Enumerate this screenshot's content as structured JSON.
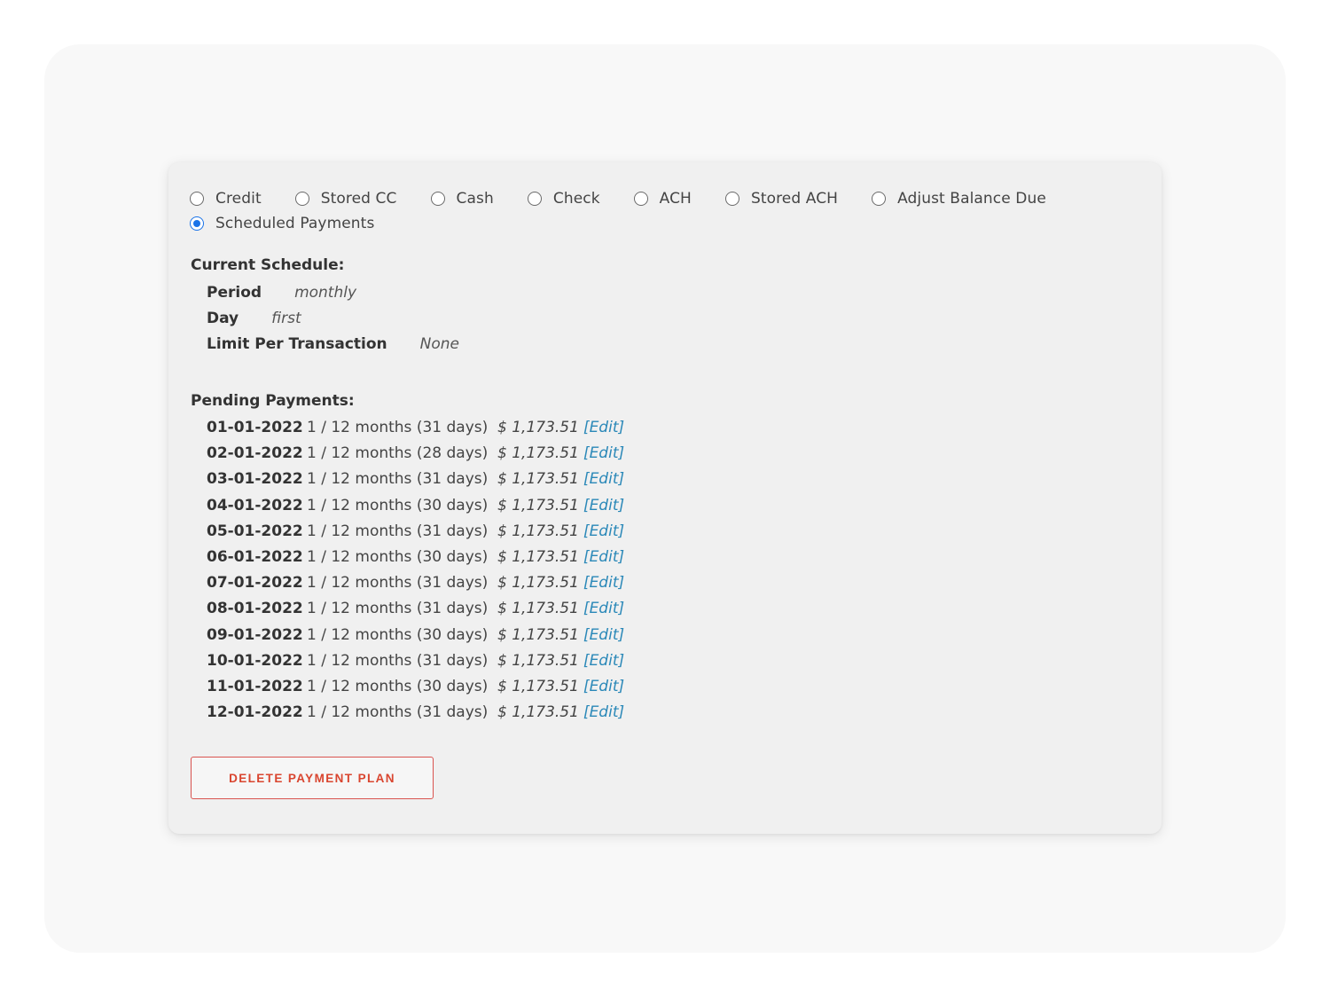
{
  "payment_methods": {
    "options": [
      {
        "label": "Credit",
        "checked": false
      },
      {
        "label": "Stored CC",
        "checked": false
      },
      {
        "label": "Cash",
        "checked": false
      },
      {
        "label": "Check",
        "checked": false
      },
      {
        "label": "ACH",
        "checked": false
      },
      {
        "label": "Stored ACH",
        "checked": false
      },
      {
        "label": "Adjust Balance Due",
        "checked": false
      },
      {
        "label": "Scheduled Payments",
        "checked": true
      }
    ]
  },
  "current_schedule": {
    "title": "Current Schedule:",
    "period_label": "Period",
    "period_value": "monthly",
    "day_label": "Day",
    "day_value": "first",
    "limit_label": "Limit Per Transaction",
    "limit_value": "None"
  },
  "pending_payments": {
    "title": "Pending Payments:",
    "rows": [
      {
        "date": "01-01-2022",
        "desc": "1 / 12 months (31 days)",
        "amount": "$ 1,173.51",
        "edit": "[Edit]"
      },
      {
        "date": "02-01-2022",
        "desc": "1 / 12 months (28 days)",
        "amount": "$ 1,173.51",
        "edit": "[Edit]"
      },
      {
        "date": "03-01-2022",
        "desc": "1 / 12 months (31 days)",
        "amount": "$ 1,173.51",
        "edit": "[Edit]"
      },
      {
        "date": "04-01-2022",
        "desc": "1 / 12 months (30 days)",
        "amount": "$ 1,173.51",
        "edit": "[Edit]"
      },
      {
        "date": "05-01-2022",
        "desc": "1 / 12 months (31 days)",
        "amount": "$ 1,173.51",
        "edit": "[Edit]"
      },
      {
        "date": "06-01-2022",
        "desc": "1 / 12 months (30 days)",
        "amount": "$ 1,173.51",
        "edit": "[Edit]"
      },
      {
        "date": "07-01-2022",
        "desc": "1 / 12 months (31 days)",
        "amount": "$ 1,173.51",
        "edit": "[Edit]"
      },
      {
        "date": "08-01-2022",
        "desc": "1 / 12 months (31 days)",
        "amount": "$ 1,173.51",
        "edit": "[Edit]"
      },
      {
        "date": "09-01-2022",
        "desc": "1 / 12 months (30 days)",
        "amount": "$ 1,173.51",
        "edit": "[Edit]"
      },
      {
        "date": "10-01-2022",
        "desc": "1 / 12 months (31 days)",
        "amount": "$ 1,173.51",
        "edit": "[Edit]"
      },
      {
        "date": "11-01-2022",
        "desc": "1 / 12 months (30 days)",
        "amount": "$ 1,173.51",
        "edit": "[Edit]"
      },
      {
        "date": "12-01-2022",
        "desc": "1 / 12 months (31 days)",
        "amount": "$ 1,173.51",
        "edit": "[Edit]"
      }
    ]
  },
  "actions": {
    "delete_label": "DELETE PAYMENT PLAN"
  },
  "colors": {
    "accent_radio": "#1a73e8",
    "edit_link": "#2a88b8",
    "danger": "#d9534f"
  }
}
